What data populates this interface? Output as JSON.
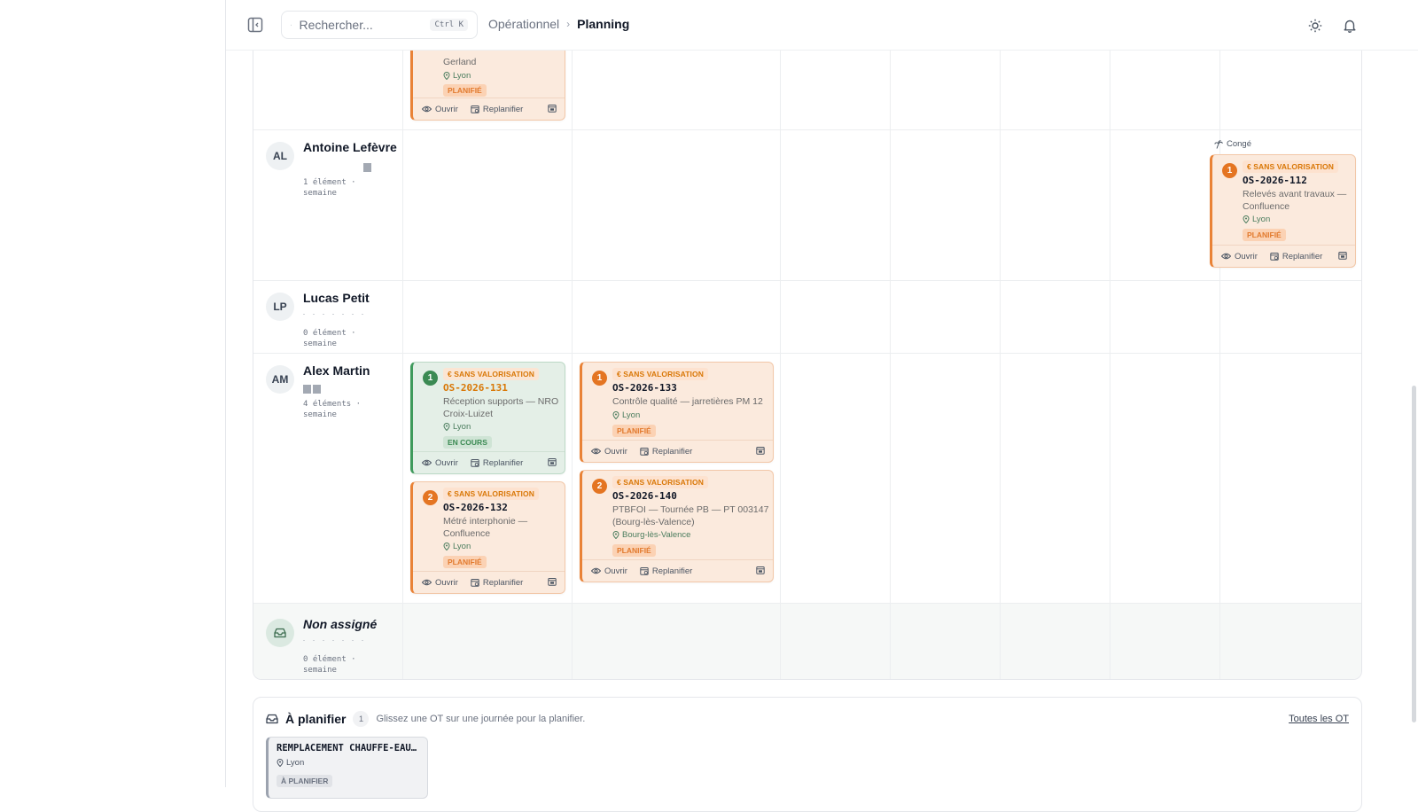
{
  "topbar": {
    "search_placeholder": "Rechercher...",
    "search_shortcut": "Ctrl K",
    "breadcrumb": [
      "Opérationnel",
      "Planning"
    ]
  },
  "rows": {
    "top_partial": {
      "card": {
        "desc": "Gerland",
        "location": "Lyon",
        "status": "PLANIFIÉ",
        "open": "Ouvrir",
        "reschedule": "Replanifier"
      }
    },
    "antoine": {
      "initials": "AL",
      "name": "Antoine Lefèvre",
      "count": "1 élément · semaine",
      "leave": "Congé",
      "card": {
        "seq": "1",
        "valuation": "€ SANS VALORISATION",
        "code": "OS-2026-112",
        "desc": "Relevés avant travaux — Confluence",
        "location": "Lyon",
        "status": "PLANIFIÉ",
        "open": "Ouvrir",
        "reschedule": "Replanifier"
      }
    },
    "lucas": {
      "initials": "LP",
      "name": "Lucas Petit",
      "count": "0 élément · semaine"
    },
    "alex": {
      "initials": "AM",
      "name": "Alex Martin",
      "count": "4 éléments · semaine",
      "cards": [
        {
          "seq": "1",
          "valuation": "€ SANS VALORISATION",
          "code": "OS-2026-131",
          "desc": "Réception supports — NRO Croix-Luizet",
          "location": "Lyon",
          "status": "EN COURS",
          "open": "Ouvrir",
          "reschedule": "Replanifier"
        },
        {
          "seq": "2",
          "valuation": "€ SANS VALORISATION",
          "code": "OS-2026-132",
          "desc": "Métré interphonie — Confluence",
          "location": "Lyon",
          "status": "PLANIFIÉ",
          "open": "Ouvrir",
          "reschedule": "Replanifier"
        },
        {
          "seq": "1",
          "valuation": "€ SANS VALORISATION",
          "code": "OS-2026-133",
          "desc": "Contrôle qualité — jarretières PM 12",
          "location": "Lyon",
          "status": "PLANIFIÉ",
          "open": "Ouvrir",
          "reschedule": "Replanifier"
        },
        {
          "seq": "2",
          "valuation": "€ SANS VALORISATION",
          "code": "OS-2026-140",
          "desc": "PTBFOI — Tournée PB — PT 003147 (Bourg-lès-Valence)",
          "location": "Bourg-lès-Valence",
          "status": "PLANIFIÉ",
          "open": "Ouvrir",
          "reschedule": "Replanifier"
        }
      ]
    },
    "unassigned": {
      "name": "Non assigné",
      "count": "0 élément · semaine"
    }
  },
  "to_plan": {
    "title": "À planifier",
    "count": "1",
    "hint": "Glissez une OT sur une journée pour la planifier.",
    "all_link": "Toutes les OT",
    "card": {
      "title": "REMPLACEMENT CHAUFFE-EAU…",
      "location": "Lyon",
      "status": "À PLANIFIER"
    }
  },
  "colors": {
    "planned_border": "#e98236",
    "planned_bg": "#fbeadd",
    "in_progress_border": "#3f9a5c",
    "in_progress_bg": "#e4efe7"
  }
}
